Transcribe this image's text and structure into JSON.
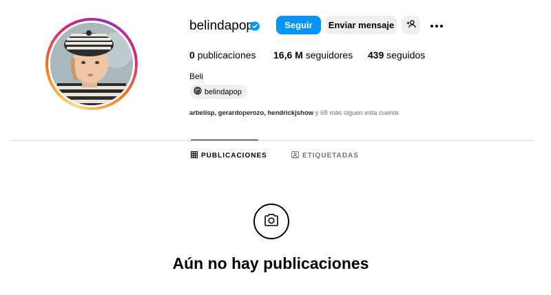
{
  "profile": {
    "username": "belindapop",
    "verified": true,
    "full_name": "Beli",
    "threads_handle": "belindapop",
    "avatar_icon": "profile-photo"
  },
  "actions": {
    "follow_label": "Seguir",
    "message_label": "Enviar mensaje",
    "suggest_icon": "person-add-icon",
    "more_icon": "more-dots-icon"
  },
  "stats": {
    "posts_count": "0",
    "posts_label": "publicaciones",
    "followers_count": "16,6 M",
    "followers_label": "seguidores",
    "following_count": "439",
    "following_label": "seguidos"
  },
  "followed_by": {
    "names": "arbelisp, gerardoperozo, hendrickjshow",
    "rest": " y 68 más siguen esta cuenta"
  },
  "tabs": [
    {
      "label": "PUBLICACIONES",
      "icon": "grid-icon",
      "active": true
    },
    {
      "label": "ETIQUETADAS",
      "icon": "tagged-icon",
      "active": false
    }
  ],
  "empty_state": {
    "icon": "camera-icon",
    "title": "Aún no hay publicaciones"
  },
  "colors": {
    "accent": "#0095f6",
    "button_gray": "#efefef",
    "muted_text": "#737373",
    "divider": "#dbdbdb"
  }
}
